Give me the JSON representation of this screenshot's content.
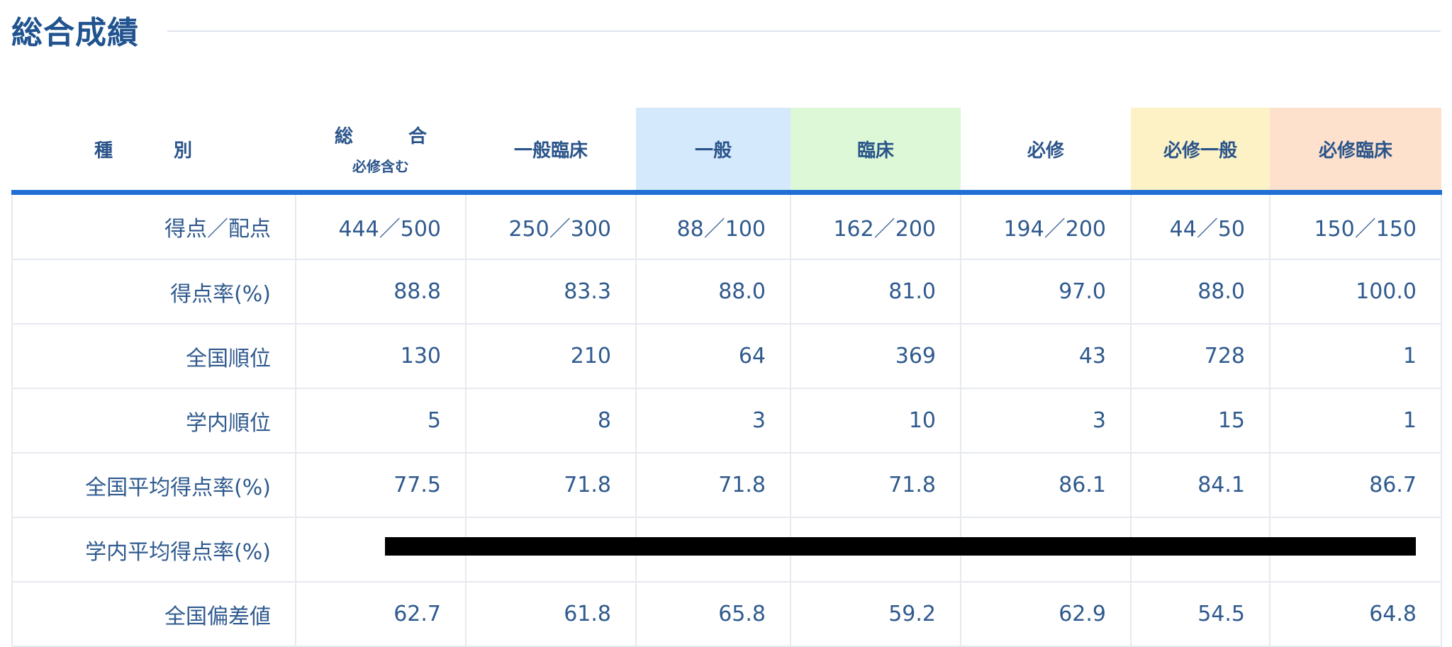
{
  "page": {
    "title": "総合成績"
  },
  "table": {
    "headers": [
      {
        "label": "種　別",
        "sub": ""
      },
      {
        "label": "総　合",
        "sub": "必修含む"
      },
      {
        "label": "一般臨床",
        "sub": ""
      },
      {
        "label": "一般",
        "sub": ""
      },
      {
        "label": "臨床",
        "sub": ""
      },
      {
        "label": "必修",
        "sub": ""
      },
      {
        "label": "必修一般",
        "sub": ""
      },
      {
        "label": "必修臨床",
        "sub": ""
      }
    ],
    "header_colors": {
      "一般": "#d4e9fb",
      "臨床": "#dcf8d6",
      "必修一般": "#fdf2c6",
      "必修臨床": "#fde1cd"
    },
    "accent_color": "#1f6fd6",
    "rows": [
      {
        "label": "得点／配点",
        "values": [
          "444／500",
          "250／300",
          "88／100",
          "162／200",
          "194／200",
          "44／50",
          "150／150"
        ]
      },
      {
        "label": "得点率(%)",
        "values": [
          "88.8",
          "83.3",
          "88.0",
          "81.0",
          "97.0",
          "88.0",
          "100.0"
        ]
      },
      {
        "label": "全国順位",
        "values": [
          "130",
          "210",
          "64",
          "369",
          "43",
          "728",
          "1"
        ]
      },
      {
        "label": "学内順位",
        "values": [
          "5",
          "8",
          "3",
          "10",
          "3",
          "15",
          "1"
        ]
      },
      {
        "label": "全国平均得点率(%)",
        "values": [
          "77.5",
          "71.8",
          "71.8",
          "71.8",
          "86.1",
          "84.1",
          "86.7"
        ]
      },
      {
        "label": "学内平均得点率(%)",
        "values": [
          "",
          "",
          "",
          "",
          "",
          "",
          ""
        ]
      },
      {
        "label": "全国偏差値",
        "values": [
          "62.7",
          "61.8",
          "65.8",
          "59.2",
          "62.9",
          "54.5",
          "64.8"
        ]
      }
    ]
  }
}
